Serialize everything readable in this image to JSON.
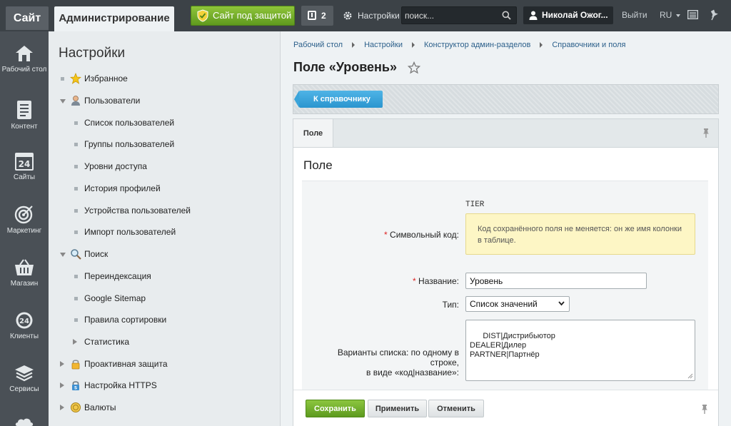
{
  "topbar": {
    "site_tab": "Сайт",
    "admin_tab": "Администрирование",
    "protect_btn": "Сайт под защитой",
    "notif_count": "2",
    "settings": "Настройки",
    "search_placeholder": "поиск...",
    "user_name": "Николай Ожог...",
    "logout": "Выйти",
    "lang": "RU"
  },
  "rail": [
    {
      "label": "Рабочий стол",
      "icon": "home-icon"
    },
    {
      "label": "Контент",
      "icon": "document-icon"
    },
    {
      "label": "Сайты",
      "icon": "calendar-24-icon"
    },
    {
      "label": "Маркетинг",
      "icon": "target-icon"
    },
    {
      "label": "Магазин",
      "icon": "basket-icon"
    },
    {
      "label": "Клиенты",
      "icon": "clients-24-icon"
    },
    {
      "label": "Сервисы",
      "icon": "layers-icon"
    }
  ],
  "menu": {
    "title": "Настройки",
    "items": [
      {
        "label": "Избранное"
      },
      {
        "label": "Пользователи"
      },
      {
        "label": "Список пользователей"
      },
      {
        "label": "Группы пользователей"
      },
      {
        "label": "Уровни доступа"
      },
      {
        "label": "История профилей"
      },
      {
        "label": "Устройства пользователей"
      },
      {
        "label": "Импорт пользователей"
      },
      {
        "label": "Поиск"
      },
      {
        "label": "Переиндексация"
      },
      {
        "label": "Google Sitemap"
      },
      {
        "label": "Правила сортировки"
      },
      {
        "label": "Статистика"
      },
      {
        "label": "Проактивная защита"
      },
      {
        "label": "Настройка HTTPS"
      },
      {
        "label": "Валюты"
      }
    ]
  },
  "breadcrumbs": [
    "Рабочий стол",
    "Настройки",
    "Конструктор админ-разделов",
    "Справочники и поля"
  ],
  "page": {
    "title": "Поле «Уровень»",
    "back_btn": "К справочнику",
    "tab": "Поле",
    "panel_title": "Поле"
  },
  "form": {
    "code_label": "Символьный код:",
    "code_value": "TIER",
    "hint": "Код сохранённого поля не меняется: он же имя колонки в таблице.",
    "name_label": "Название:",
    "name_value": "Уровень",
    "type_label": "Тип:",
    "type_value": "Список значений",
    "variants_label_1": "Варианты списка: по одному в строке,",
    "variants_label_2": "в виде «код|название»:",
    "variants_value": "DIST|Дистрибьютор\nDEALER|Дилер\nPARTNER|Партнёр",
    "required_mark": "*"
  },
  "buttons": {
    "save": "Сохранить",
    "apply": "Применить",
    "cancel": "Отменить"
  },
  "colors": {
    "accent_blue": "#2a95cf",
    "save_green": "#5d9a1f",
    "hint_yellow": "#fdf6c5"
  }
}
